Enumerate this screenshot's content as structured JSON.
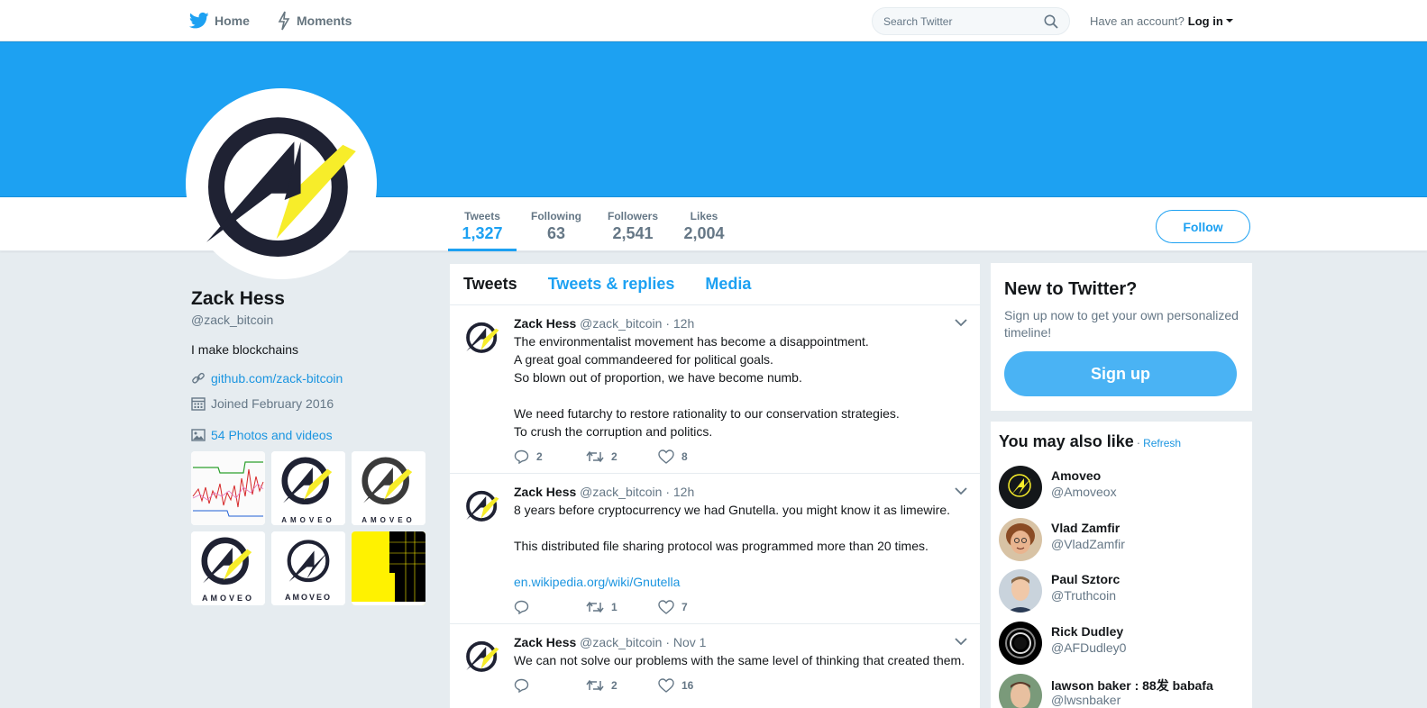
{
  "nav": {
    "home_label": "Home",
    "moments_label": "Moments"
  },
  "search": {
    "placeholder": "Search Twitter"
  },
  "account": {
    "prompt": "Have an account?",
    "login_label": "Log in"
  },
  "stats": [
    {
      "label": "Tweets",
      "value": "1,327"
    },
    {
      "label": "Following",
      "value": "63"
    },
    {
      "label": "Followers",
      "value": "2,541"
    },
    {
      "label": "Likes",
      "value": "2,004"
    }
  ],
  "follow_label": "Follow",
  "profile": {
    "name": "Zack Hess",
    "handle": "@zack_bitcoin",
    "bio": "I make blockchains",
    "website": "github.com/zack-bitcoin",
    "joined": "Joined February 2016",
    "photos_label": "54 Photos and videos",
    "thumb_caption": "AMOVEO"
  },
  "timeline_tabs": [
    "Tweets",
    "Tweets & replies",
    "Media"
  ],
  "tweets": [
    {
      "name": "Zack Hess",
      "handle": "@zack_bitcoin",
      "time": "· 12h",
      "lines": [
        "The environmentalist movement has become a disappointment.",
        "A great goal commandeered for political goals.",
        "So blown out of proportion, we have become numb.",
        "",
        "We need futarchy to restore rationality to our conservation strategies.",
        "To crush the corruption and politics."
      ],
      "link": "",
      "replies": "2",
      "retweets": "2",
      "likes": "8"
    },
    {
      "name": "Zack Hess",
      "handle": "@zack_bitcoin",
      "time": "· 12h",
      "lines": [
        "8 years before cryptocurrency we had Gnutella. you might know it as limewire.",
        "",
        "This distributed file sharing protocol was programmed more than 20 times.",
        ""
      ],
      "link": "en.wikipedia.org/wiki/Gnutella",
      "replies": "",
      "retweets": "1",
      "likes": "7"
    },
    {
      "name": "Zack Hess",
      "handle": "@zack_bitcoin",
      "time": "· Nov 1",
      "lines": [
        "We can not solve our problems with the same level of thinking that created them."
      ],
      "link": "",
      "replies": "",
      "retweets": "2",
      "likes": "16"
    }
  ],
  "signup": {
    "title": "New to Twitter?",
    "subtitle": "Sign up now to get your own personalized timeline!",
    "button": "Sign up"
  },
  "wtf": {
    "title": "You may also like",
    "dot": "·",
    "refresh": "Refresh",
    "users": [
      {
        "name": "Amoveo",
        "handle": "@Amoveox"
      },
      {
        "name": "Vlad Zamfir",
        "handle": "@VladZamfir"
      },
      {
        "name": "Paul Sztorc",
        "handle": "@Truthcoin"
      },
      {
        "name": "Rick Dudley",
        "handle": "@AFDudley0"
      },
      {
        "name": "lawson baker : 88发 babafa",
        "handle": "@lwsnbaker"
      }
    ]
  },
  "colors": {
    "brand": "#1da1f2",
    "logo_dark": "#1f2233",
    "logo_yellow": "#f7ed2a"
  },
  "icons": [
    "twitter-bird-icon",
    "lightning-icon",
    "search-icon",
    "caret-down-icon",
    "link-icon",
    "calendar-icon",
    "photo-icon",
    "reply-icon",
    "retweet-icon",
    "heart-icon",
    "chevron-down-icon"
  ]
}
